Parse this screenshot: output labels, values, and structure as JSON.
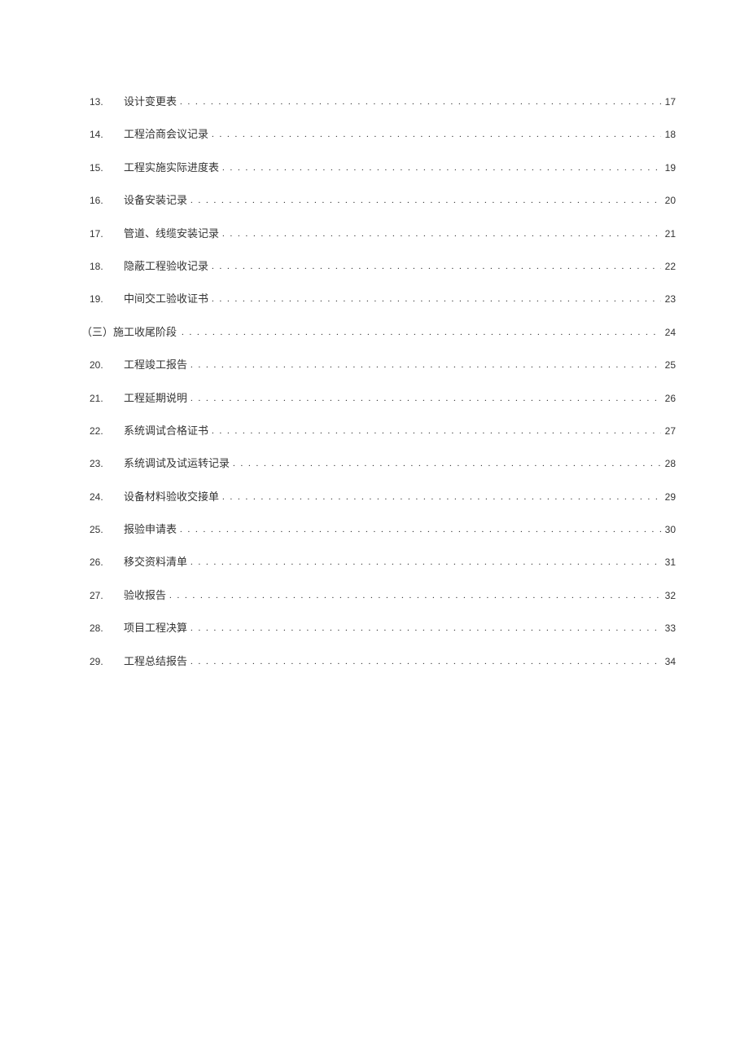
{
  "toc": {
    "items": [
      {
        "num": "13.",
        "title": "设计变更表",
        "page": "17"
      },
      {
        "num": "14.",
        "title": "工程洽商会议记录",
        "page": "18"
      },
      {
        "num": "15.",
        "title": "工程实施实际进度表",
        "page": "19"
      },
      {
        "num": "16.",
        "title": "设备安装记录",
        "page": "20"
      },
      {
        "num": "17.",
        "title": "管道、线缆安装记录",
        "page": "21"
      },
      {
        "num": "18.",
        "title": "隐蔽工程验收记录",
        "page": "22"
      },
      {
        "num": "19.",
        "title": "中间交工验收证书",
        "page": "23"
      }
    ],
    "section": {
      "prefix": "（三）施工收尾阶段 ",
      "page": "24"
    },
    "items2": [
      {
        "num": "20.",
        "title": "工程竣工报告",
        "page": "25"
      },
      {
        "num": "21.",
        "title": "工程延期说明",
        "page": "26"
      },
      {
        "num": "22.",
        "title": "系统调试合格证书",
        "page": "27"
      },
      {
        "num": "23.",
        "title": "系统调试及试运转记录",
        "page": "28"
      },
      {
        "num": "24.",
        "title": "设备材料验收交接单",
        "page": "29"
      },
      {
        "num": "25.",
        "title": "报验申请表",
        "page": "30"
      },
      {
        "num": "26.",
        "title": "移交资料清单",
        "page": "31"
      },
      {
        "num": "27.",
        "title": "验收报告",
        "page": "32"
      },
      {
        "num": "28.",
        "title": "项目工程决算",
        "page": "33"
      },
      {
        "num": "29.",
        "title": "工程总结报告",
        "page": "34"
      }
    ]
  }
}
